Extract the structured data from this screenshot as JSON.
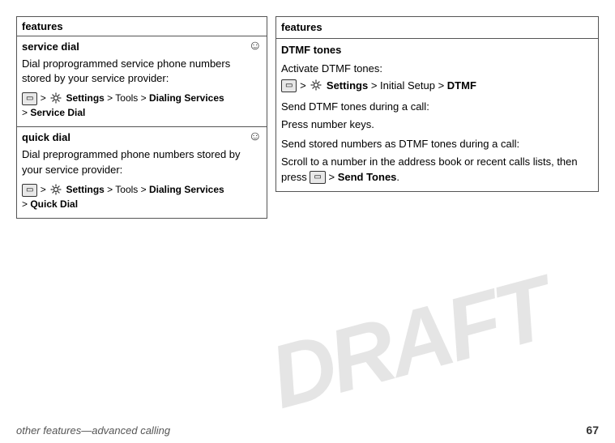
{
  "page": {
    "draft_watermark": "DRAFT"
  },
  "left_table": {
    "header": "features",
    "rows": [
      {
        "title": "service dial",
        "has_icon": true,
        "desc": "Dial proprogrammed service phone numbers stored by your service provider:",
        "path_prefix": "> ",
        "path_settings": "Settings",
        "path_middle": " > Tools > ",
        "path_bold1": "Dialing Services",
        "path_suffix": "\n> ",
        "path_bold2": "Service Dial"
      },
      {
        "title": "quick dial",
        "has_icon": true,
        "desc": "Dial preprogrammed phone numbers stored by your service provider:",
        "path_prefix": "> ",
        "path_settings": "Settings",
        "path_middle": " > Tools > ",
        "path_bold1": "Dialing Services",
        "path_suffix": "\n> ",
        "path_bold2": "Quick Dial"
      }
    ]
  },
  "right_table": {
    "header": "features",
    "title": "DTMF tones",
    "sections": [
      {
        "label": "Activate DTMF tones:",
        "path": true,
        "path_settings": "Settings",
        "path_middle": " > Initial Setup > ",
        "path_bold": "DTMF"
      },
      {
        "label": "Send DTMF tones during a call:"
      },
      {
        "label": "Press number keys."
      },
      {
        "label": "Send stored numbers as DTMF tones during a call:"
      },
      {
        "label": "Scroll to a number in the address book or recent calls lists, then press",
        "inline_end": " > Send Tones."
      }
    ]
  },
  "footer": {
    "left": "other features—advanced calling",
    "right": "67"
  }
}
